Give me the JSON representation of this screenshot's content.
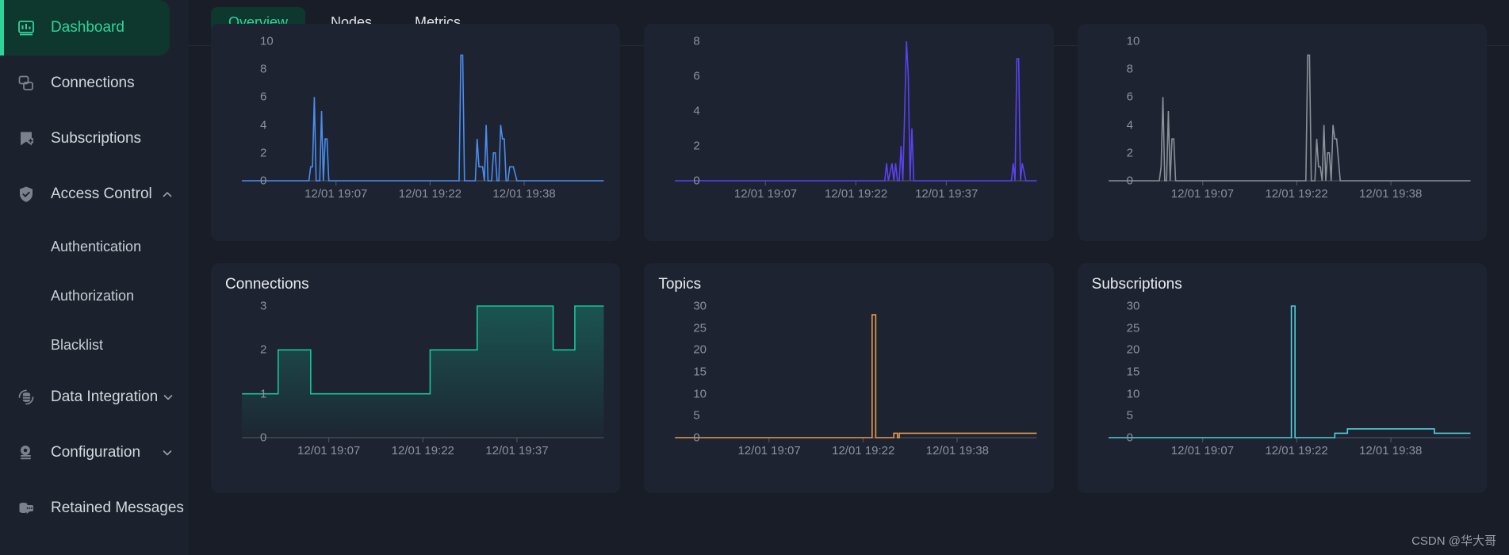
{
  "sidebar": {
    "items": [
      {
        "label": "Dashboard",
        "icon": "chart-bar-icon",
        "active": true,
        "sub": false,
        "chevron": ""
      },
      {
        "label": "Connections",
        "icon": "connections-icon",
        "active": false,
        "sub": false,
        "chevron": ""
      },
      {
        "label": "Subscriptions",
        "icon": "bookmark-plus-icon",
        "active": false,
        "sub": false,
        "chevron": ""
      },
      {
        "label": "Access Control",
        "icon": "shield-check-icon",
        "active": false,
        "sub": false,
        "chevron": "chevron-up-icon"
      },
      {
        "label": "Authentication",
        "icon": "",
        "active": false,
        "sub": true,
        "chevron": ""
      },
      {
        "label": "Authorization",
        "icon": "",
        "active": false,
        "sub": true,
        "chevron": ""
      },
      {
        "label": "Blacklist",
        "icon": "",
        "active": false,
        "sub": true,
        "chevron": ""
      },
      {
        "label": "Data Integration",
        "icon": "database-sync-icon",
        "active": false,
        "sub": false,
        "chevron": "chevron-down-icon"
      },
      {
        "label": "Configuration",
        "icon": "gear-stack-icon",
        "active": false,
        "sub": false,
        "chevron": "chevron-down-icon"
      },
      {
        "label": "Retained Messages",
        "icon": "database-message-icon",
        "active": false,
        "sub": false,
        "chevron": ""
      }
    ]
  },
  "tabs": [
    {
      "label": "Overview",
      "active": true
    },
    {
      "label": "Nodes",
      "active": false
    },
    {
      "label": "Metrics",
      "active": false
    }
  ],
  "colors": {
    "accent": "#2fd49a",
    "sidebar_bg": "#1b222d",
    "main_bg": "#181d27",
    "card_bg": "#1d2330",
    "axis_text": "#8b919c",
    "series_blue": "#4a8ef0",
    "series_purple": "#5b41f0",
    "series_gray": "#8b9099",
    "series_teal": "#14c79b",
    "series_orange": "#e89a4e",
    "series_cyan": "#4fd0d9"
  },
  "watermark": "CSDN @华大哥",
  "chart_data": [
    {
      "id": "incoming-messages",
      "type": "line",
      "title": "",
      "color": "#4a8ef0",
      "filled": false,
      "ylabel": "",
      "xlabel": "",
      "yticks": [
        0,
        2,
        4,
        6,
        8,
        10
      ],
      "ylim": [
        0,
        10
      ],
      "xticks": [
        "12/01 19:07",
        "12/01 19:22",
        "12/01 19:38"
      ],
      "xtick_positions": [
        0.26,
        0.52,
        0.78
      ],
      "x": [
        0,
        0.04,
        0.08,
        0.12,
        0.16,
        0.185,
        0.19,
        0.195,
        0.2,
        0.205,
        0.21,
        0.215,
        0.22,
        0.225,
        0.23,
        0.235,
        0.24,
        0.245,
        0.25,
        0.26,
        0.3,
        0.36,
        0.42,
        0.48,
        0.54,
        0.58,
        0.6,
        0.605,
        0.61,
        0.615,
        0.62,
        0.63,
        0.645,
        0.65,
        0.655,
        0.66,
        0.665,
        0.67,
        0.675,
        0.68,
        0.69,
        0.695,
        0.7,
        0.705,
        0.71,
        0.715,
        0.72,
        0.725,
        0.73,
        0.735,
        0.74,
        0.75,
        0.76,
        0.77,
        0.78,
        0.82,
        0.88,
        0.94,
        1.0
      ],
      "y": [
        0,
        0,
        0,
        0,
        0,
        0,
        1,
        1,
        6,
        0,
        0,
        0,
        5,
        0,
        3,
        3,
        0,
        0,
        0,
        0,
        0,
        0,
        0,
        0,
        0,
        0,
        0,
        9,
        9,
        0,
        0,
        0,
        0,
        3,
        1,
        1,
        1,
        0,
        4,
        0,
        0,
        2,
        2,
        0,
        0,
        4,
        3,
        3,
        0,
        0,
        1,
        1,
        0,
        0,
        0,
        0,
        0,
        0,
        0
      ]
    },
    {
      "id": "outgoing-messages",
      "type": "line",
      "title": "",
      "color": "#5b41f0",
      "filled": false,
      "ylabel": "",
      "xlabel": "",
      "yticks": [
        0,
        2,
        4,
        6,
        8
      ],
      "ylim": [
        0,
        8
      ],
      "xticks": [
        "12/01 19:07",
        "12/01 19:22",
        "12/01 19:37"
      ],
      "xtick_positions": [
        0.25,
        0.5,
        0.75
      ],
      "x": [
        0,
        0.1,
        0.2,
        0.3,
        0.4,
        0.55,
        0.58,
        0.585,
        0.59,
        0.6,
        0.605,
        0.61,
        0.615,
        0.62,
        0.625,
        0.63,
        0.64,
        0.645,
        0.65,
        0.655,
        0.66,
        0.665,
        0.67,
        0.68,
        0.7,
        0.78,
        0.88,
        0.93,
        0.935,
        0.94,
        0.945,
        0.95,
        0.955,
        0.96,
        0.97,
        1.0
      ],
      "y": [
        0,
        0,
        0,
        0,
        0,
        0,
        0,
        1,
        0,
        1,
        0,
        1,
        0,
        0,
        2,
        0,
        8,
        6,
        0,
        3,
        0,
        0,
        0,
        0,
        0,
        0,
        0,
        0,
        1,
        0,
        7,
        7,
        0,
        1,
        0,
        0
      ]
    },
    {
      "id": "dropped-messages",
      "type": "line",
      "title": "",
      "color": "#8b9099",
      "filled": false,
      "ylabel": "",
      "xlabel": "",
      "yticks": [
        0,
        2,
        4,
        6,
        8,
        10
      ],
      "ylim": [
        0,
        10
      ],
      "xticks": [
        "12/01 19:07",
        "12/01 19:22",
        "12/01 19:38"
      ],
      "xtick_positions": [
        0.26,
        0.52,
        0.78
      ],
      "x": [
        0,
        0.04,
        0.08,
        0.12,
        0.14,
        0.145,
        0.15,
        0.155,
        0.16,
        0.165,
        0.17,
        0.175,
        0.18,
        0.185,
        0.19,
        0.2,
        0.26,
        0.34,
        0.42,
        0.5,
        0.54,
        0.545,
        0.55,
        0.555,
        0.56,
        0.565,
        0.57,
        0.575,
        0.58,
        0.585,
        0.59,
        0.595,
        0.6,
        0.605,
        0.61,
        0.615,
        0.62,
        0.625,
        0.63,
        0.64,
        0.66,
        0.72,
        0.8,
        0.88,
        1.0
      ],
      "y": [
        0,
        0,
        0,
        0,
        0,
        1,
        6,
        0,
        0,
        5,
        0,
        3,
        3,
        0,
        0,
        0,
        0,
        0,
        0,
        0,
        0,
        0,
        9,
        9,
        0,
        0,
        0,
        3,
        1,
        1,
        0,
        4,
        0,
        2,
        2,
        0,
        4,
        3,
        3,
        0,
        0,
        0,
        0,
        0,
        0
      ]
    },
    {
      "id": "connections",
      "type": "area",
      "title": "Connections",
      "color": "#14c79b",
      "filled": true,
      "ylabel": "",
      "xlabel": "",
      "yticks": [
        0,
        1,
        2,
        3
      ],
      "ylim": [
        0,
        3
      ],
      "xticks": [
        "12/01 19:07",
        "12/01 19:22",
        "12/01 19:37"
      ],
      "xtick_positions": [
        0.24,
        0.5,
        0.76
      ],
      "x": [
        0,
        0.1,
        0.1,
        0.19,
        0.19,
        0.52,
        0.52,
        0.65,
        0.65,
        0.86,
        0.86,
        0.92,
        0.92,
        0.97,
        0.97,
        1.0
      ],
      "y": [
        1,
        1,
        2,
        2,
        1,
        1,
        2,
        2,
        3,
        3,
        2,
        2,
        3,
        3,
        3,
        3
      ],
      "step": true
    },
    {
      "id": "topics",
      "type": "line",
      "title": "Topics",
      "color": "#e89a4e",
      "filled": false,
      "ylabel": "",
      "xlabel": "",
      "yticks": [
        0,
        5,
        10,
        15,
        20,
        25,
        30
      ],
      "ylim": [
        0,
        30
      ],
      "xticks": [
        "12/01 19:07",
        "12/01 19:22",
        "12/01 19:38"
      ],
      "xtick_positions": [
        0.26,
        0.52,
        0.78
      ],
      "x": [
        0,
        0.1,
        0.2,
        0.3,
        0.4,
        0.5,
        0.54,
        0.545,
        0.55,
        0.555,
        0.56,
        0.58,
        0.6,
        0.605,
        0.61,
        0.615,
        0.62,
        0.64,
        0.66,
        0.68,
        0.7,
        0.8,
        0.9,
        1.0
      ],
      "y": [
        0,
        0,
        0,
        0,
        0,
        0,
        0,
        28,
        28,
        0,
        0,
        0,
        0,
        1,
        1,
        0,
        1,
        1,
        1,
        1,
        1,
        1,
        1,
        1
      ],
      "step": true
    },
    {
      "id": "subscriptions",
      "type": "line",
      "title": "Subscriptions",
      "color": "#4fd0d9",
      "filled": false,
      "ylabel": "",
      "xlabel": "",
      "yticks": [
        0,
        5,
        10,
        15,
        20,
        25,
        30
      ],
      "ylim": [
        0,
        30
      ],
      "xticks": [
        "12/01 19:07",
        "12/01 19:22",
        "12/01 19:38"
      ],
      "xtick_positions": [
        0.26,
        0.52,
        0.78
      ],
      "x": [
        0,
        0.1,
        0.2,
        0.3,
        0.4,
        0.48,
        0.5,
        0.505,
        0.51,
        0.515,
        0.52,
        0.55,
        0.6,
        0.625,
        0.625,
        0.66,
        0.66,
        0.7,
        0.7,
        0.86,
        0.86,
        0.9,
        0.9,
        1.0
      ],
      "y": [
        0,
        0,
        0,
        0,
        0,
        0,
        0,
        30,
        30,
        0,
        0,
        0,
        0,
        0,
        1,
        1,
        2,
        2,
        2,
        2,
        2,
        2,
        1,
        1
      ],
      "step": true
    }
  ]
}
